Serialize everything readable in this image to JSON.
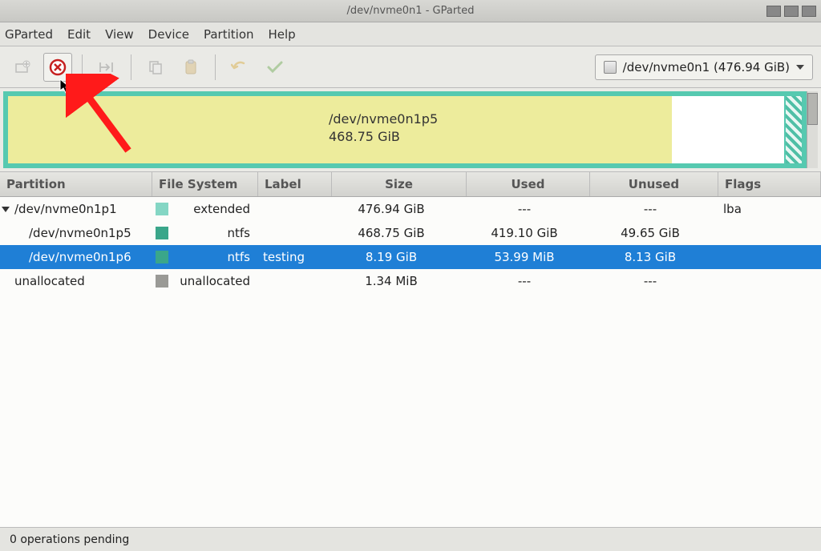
{
  "title": "/dev/nvme0n1 - GParted",
  "menu": {
    "gparted": "GParted",
    "edit": "Edit",
    "view": "View",
    "device": "Device",
    "partition": "Partition",
    "help": "Help"
  },
  "toolbar": {
    "new": "new",
    "delete": "delete",
    "resize": "resize",
    "copy": "copy",
    "paste": "paste",
    "undo": "undo",
    "apply": "apply"
  },
  "device_selector": {
    "label": "/dev/nvme0n1  (476.94 GiB)"
  },
  "graph": {
    "partition": "/dev/nvme0n1p5",
    "size": "468.75 GiB",
    "used_fraction": 0.855
  },
  "columns": {
    "partition": "Partition",
    "filesystem": "File System",
    "label": "Label",
    "size": "Size",
    "used": "Used",
    "unused": "Unused",
    "flags": "Flags"
  },
  "rows": [
    {
      "partition": "/dev/nvme0n1p1",
      "indent": 0,
      "expander": true,
      "swatch": "sw-extended",
      "filesystem": "extended",
      "label": "",
      "size": "476.94 GiB",
      "used": "---",
      "unused": "---",
      "flags": "lba",
      "selected": false
    },
    {
      "partition": "/dev/nvme0n1p5",
      "indent": 1,
      "expander": false,
      "swatch": "sw-ntfs",
      "filesystem": "ntfs",
      "label": "",
      "size": "468.75 GiB",
      "used": "419.10 GiB",
      "unused": "49.65 GiB",
      "flags": "",
      "selected": false
    },
    {
      "partition": "/dev/nvme0n1p6",
      "indent": 1,
      "expander": false,
      "swatch": "sw-ntfs",
      "filesystem": "ntfs",
      "label": "testing",
      "size": "8.19 GiB",
      "used": "53.99 MiB",
      "unused": "8.13 GiB",
      "flags": "",
      "selected": true
    },
    {
      "partition": "unallocated",
      "indent": 0,
      "expander": false,
      "swatch": "sw-unalloc",
      "filesystem": "unallocated",
      "label": "",
      "size": "1.34 MiB",
      "used": "---",
      "unused": "---",
      "flags": "",
      "selected": false
    }
  ],
  "status": "0 operations pending"
}
